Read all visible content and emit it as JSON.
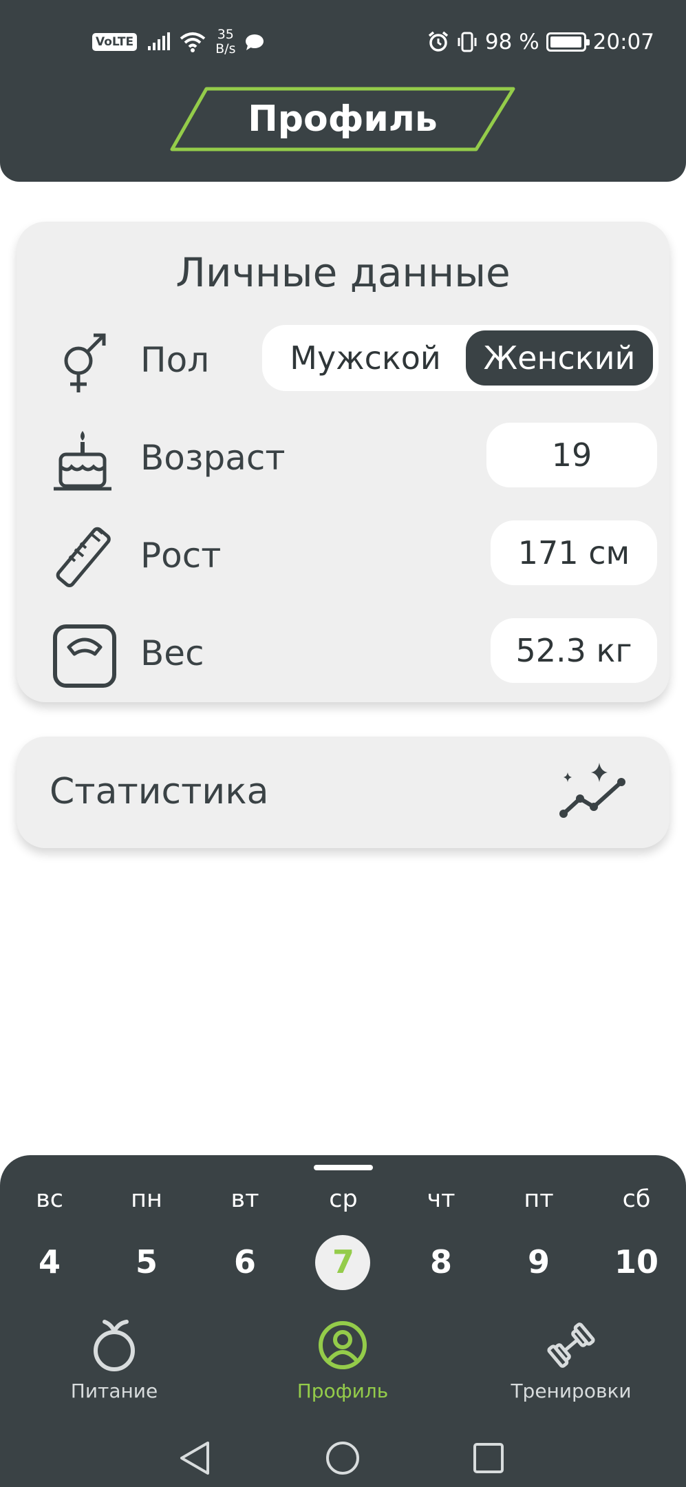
{
  "status_bar": {
    "volte": "VoLTE",
    "net_speed_value": "35",
    "net_speed_unit": "B/s",
    "battery_percent": "98 %",
    "battery_level": 0.98,
    "time": "20:07"
  },
  "header": {
    "title": "Профиль",
    "accent_color": "#94cc4a",
    "bg_color": "#3a4245"
  },
  "personal": {
    "title": "Личные данные",
    "gender": {
      "label": "Пол",
      "options": [
        "Мужской",
        "Женский"
      ],
      "selected": "Женский"
    },
    "age": {
      "label": "Возраст",
      "value": "19"
    },
    "height": {
      "label": "Рост",
      "value": "171  см"
    },
    "weight": {
      "label": "Вес",
      "value": "52.3  кг"
    }
  },
  "stats": {
    "label": "Статистика",
    "icon": "stats-sparkle-icon"
  },
  "calendar": {
    "days": [
      {
        "name": "вс",
        "num": "4"
      },
      {
        "name": "пн",
        "num": "5"
      },
      {
        "name": "вт",
        "num": "6"
      },
      {
        "name": "ср",
        "num": "7"
      },
      {
        "name": "чт",
        "num": "8"
      },
      {
        "name": "пт",
        "num": "9"
      },
      {
        "name": "сб",
        "num": "10"
      }
    ],
    "selected_index": 3
  },
  "bottom_nav": {
    "items": [
      {
        "label": "Питание",
        "icon": "apple-icon"
      },
      {
        "label": "Профиль",
        "icon": "profile-icon"
      },
      {
        "label": "Тренировки",
        "icon": "dumbbell-icon"
      }
    ],
    "active_index": 1
  }
}
